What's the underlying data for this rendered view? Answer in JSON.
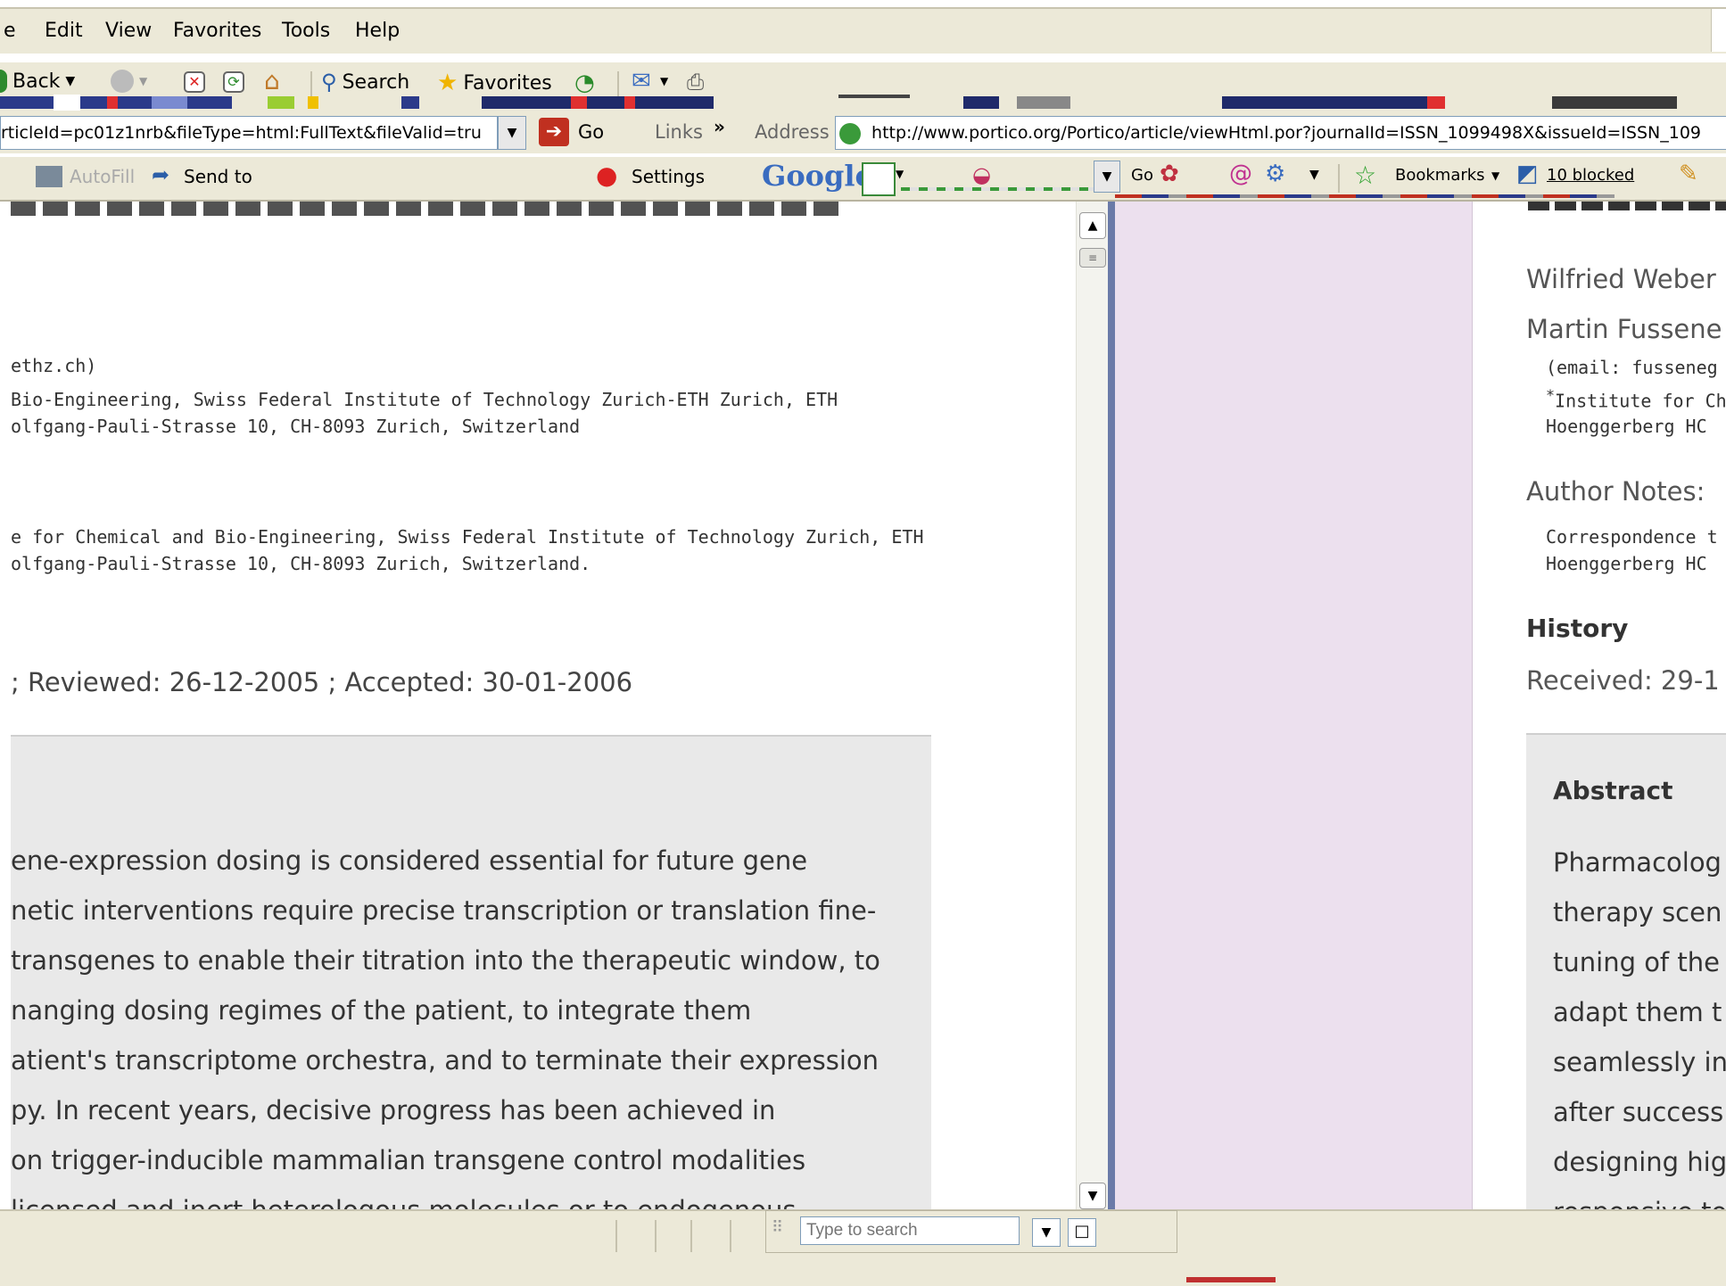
{
  "menubar": {
    "items": [
      "e",
      "Edit",
      "View",
      "Favorites",
      "Tools",
      "Help"
    ]
  },
  "toolbar": {
    "back_label": "Back",
    "search_label": "Search",
    "favorites_label": "Favorites"
  },
  "address_bar": {
    "left_url_fragment": "rticleId=pc01z1nrb&fileType=html:FullText&fileValid=tru",
    "go_label": "Go",
    "links_label": "Links",
    "address_label": "Address",
    "url": "http://www.portico.org/Portico/article/viewHtml.por?journalId=ISSN_1099498X&issueId=ISSN_109"
  },
  "links_toolbar": {
    "autofill_label": "AutoFill",
    "send_to_label": "Send to",
    "settings_label": "Settings",
    "google_label": "Google",
    "go_label": "Go",
    "bookmarks_label": "Bookmarks",
    "blocked_label": "10 blocked"
  },
  "left_article": {
    "email_line": "ethz.ch)",
    "affil1_line1": "Bio-Engineering, Swiss Federal Institute of Technology Zurich-ETH Zurich, ETH",
    "affil1_line2": "olfgang-Pauli-Strasse 10, CH-8093 Zurich, Switzerland",
    "affil2_line1": "e for Chemical and Bio-Engineering, Swiss Federal Institute of Technology Zurich, ETH",
    "affil2_line2": "olfgang-Pauli-Strasse 10, CH-8093 Zurich, Switzerland.",
    "history_line": "; Reviewed: 26-12-2005 ; Accepted: 30-01-2006",
    "abstract_lines": [
      "ene-expression dosing is considered essential for future gene",
      "netic interventions require precise transcription or translation fine-",
      "transgenes to enable their titration into the therapeutic window, to",
      "nanging dosing regimes of the patient, to integrate them",
      "atient's transcriptome orchestra, and to terminate their expression",
      "py. In recent years, decisive progress has been achieved in",
      "on trigger-inducible mammalian transgene control modalities",
      "licensed and inert heterologous molecules or to endogenous"
    ]
  },
  "right_article": {
    "author1": "Wilfried Weber",
    "author2": "Martin Fussene",
    "email_line": "(email: fusseneg",
    "affil_line1": "Institute for Che",
    "affil_line2": "Hoenggerberg HC",
    "author_notes_heading": "Author Notes:",
    "notes_line1": "Correspondence t",
    "notes_line2": "Hoenggerberg HC",
    "history_heading": "History",
    "received_line": "Received: 29-1",
    "abstract_heading": "Abstract",
    "abstract_lines": [
      "Pharmacolog",
      "therapy scen",
      "tuning of the",
      "adapt them t",
      "seamlessly in",
      "after success",
      "designing hig",
      "responsive to"
    ]
  },
  "statusbar": {
    "search_placeholder": "Type to search"
  }
}
